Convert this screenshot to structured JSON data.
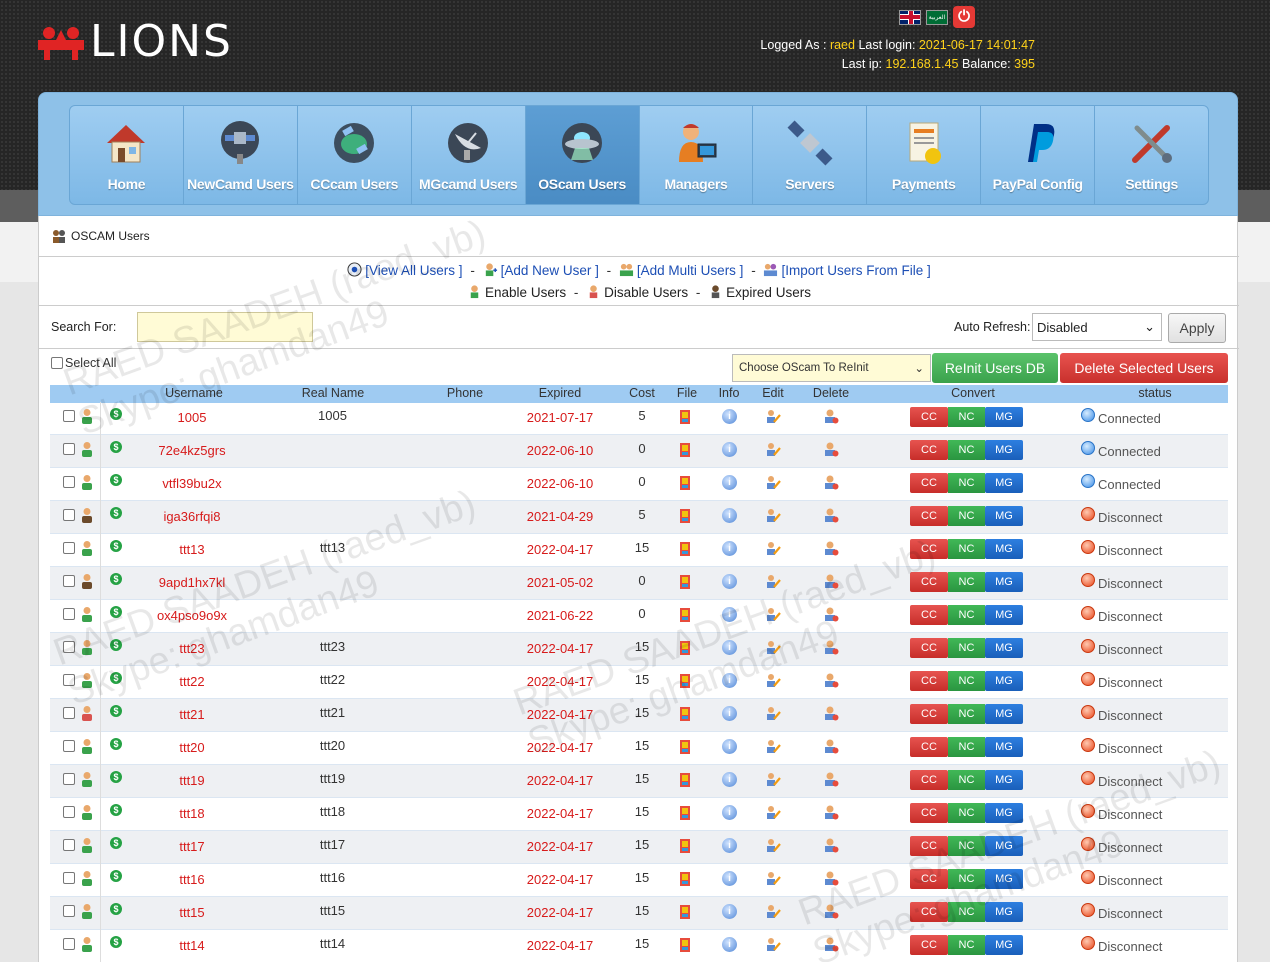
{
  "app": {
    "logo_text": "LIONS",
    "logged_as_label": "Logged As :",
    "logged_as_value": "raed",
    "last_login_label": "Last login:",
    "last_login_value": "2021-06-17 14:01:47",
    "last_ip_label": "Last ip:",
    "last_ip_value": "192.168.1.45",
    "balance_label": "Balance:",
    "balance_value": "395",
    "flag_sa_text": "العربية"
  },
  "nav": [
    {
      "label": "Home",
      "icon": "home-icon"
    },
    {
      "label": "NewCamd Users",
      "icon": "satellite-dish-icon"
    },
    {
      "label": "CCcam Users",
      "icon": "globe-satellite-icon"
    },
    {
      "label": "MGcamd Users",
      "icon": "dish-antenna-icon"
    },
    {
      "label": "OScam Users",
      "icon": "ufo-icon",
      "active": true
    },
    {
      "label": "Managers",
      "icon": "manager-icon"
    },
    {
      "label": "Servers",
      "icon": "satellite-icon"
    },
    {
      "label": "Payments",
      "icon": "invoice-icon"
    },
    {
      "label": "PayPal Config",
      "icon": "paypal-icon"
    },
    {
      "label": "Settings",
      "icon": "tools-icon"
    }
  ],
  "page": {
    "breadcrumb": "OSCAM Users",
    "links": {
      "view_all": "[View All Users ]",
      "add_new": "[Add New User ]",
      "add_multi": "[Add Multi Users ]",
      "import": "[Import Users From File ]",
      "enable": "Enable Users",
      "disable": "Disable Users",
      "expired": "Expired Users",
      "sep": "-"
    },
    "search_label": "Search For:",
    "search_value": "",
    "auto_refresh_label": "Auto Refresh:",
    "auto_refresh_value": "Disabled",
    "apply_label": "Apply",
    "select_all_label": "Select All",
    "reinit_placeholder": "Choose OScam To ReInit",
    "reinit_button": "ReInit Users DB",
    "delete_button": "Delete Selected Users"
  },
  "table": {
    "columns": {
      "username": "Username",
      "real_name": "Real Name",
      "phone": "Phone",
      "expired": "Expired",
      "cost": "Cost",
      "file": "File",
      "info": "Info",
      "edit": "Edit",
      "delete": "Delete",
      "convert": "Convert",
      "status": "status"
    },
    "convert_labels": {
      "cc": "CC",
      "nc": "NC",
      "mg": "MG"
    },
    "rows": [
      {
        "username": "1005",
        "real_name": "1005",
        "expired": "2021-07-17",
        "cost": "5",
        "status": "Connected",
        "online": true
      },
      {
        "username": "72e4kz5grs",
        "real_name": "",
        "expired": "2022-06-10",
        "cost": "0",
        "status": "Connected",
        "online": true
      },
      {
        "username": "vtfl39bu2x",
        "real_name": "",
        "expired": "2022-06-10",
        "cost": "0",
        "status": "Connected",
        "online": true
      },
      {
        "username": "iga36rfqi8",
        "real_name": "",
        "expired": "2021-04-29",
        "cost": "5",
        "status": "Disconnect",
        "online": false
      },
      {
        "username": "ttt13",
        "real_name": "ttt13",
        "expired": "2022-04-17",
        "cost": "15",
        "status": "Disconnect",
        "online": false
      },
      {
        "username": "9apd1hx7kl",
        "real_name": "",
        "expired": "2021-05-02",
        "cost": "0",
        "status": "Disconnect",
        "online": false
      },
      {
        "username": "ox4pso9o9x",
        "real_name": "",
        "expired": "2021-06-22",
        "cost": "0",
        "status": "Disconnect",
        "online": false
      },
      {
        "username": "ttt23",
        "real_name": "ttt23",
        "expired": "2022-04-17",
        "cost": "15",
        "status": "Disconnect",
        "online": false
      },
      {
        "username": "ttt22",
        "real_name": "ttt22",
        "expired": "2022-04-17",
        "cost": "15",
        "status": "Disconnect",
        "online": false
      },
      {
        "username": "ttt21",
        "real_name": "ttt21",
        "expired": "2022-04-17",
        "cost": "15",
        "status": "Disconnect",
        "online": false
      },
      {
        "username": "ttt20",
        "real_name": "ttt20",
        "expired": "2022-04-17",
        "cost": "15",
        "status": "Disconnect",
        "online": false
      },
      {
        "username": "ttt19",
        "real_name": "ttt19",
        "expired": "2022-04-17",
        "cost": "15",
        "status": "Disconnect",
        "online": false
      },
      {
        "username": "ttt18",
        "real_name": "ttt18",
        "expired": "2022-04-17",
        "cost": "15",
        "status": "Disconnect",
        "online": false
      },
      {
        "username": "ttt17",
        "real_name": "ttt17",
        "expired": "2022-04-17",
        "cost": "15",
        "status": "Disconnect",
        "online": false
      },
      {
        "username": "ttt16",
        "real_name": "ttt16",
        "expired": "2022-04-17",
        "cost": "15",
        "status": "Disconnect",
        "online": false
      },
      {
        "username": "ttt15",
        "real_name": "ttt15",
        "expired": "2022-04-17",
        "cost": "15",
        "status": "Disconnect",
        "online": false
      },
      {
        "username": "ttt14",
        "real_name": "ttt14",
        "expired": "2022-04-17",
        "cost": "15",
        "status": "Disconnect",
        "online": false
      }
    ]
  },
  "watermark": {
    "line1": "RAED SAADEH (raed_vb)",
    "line2": "Skype: ghamdan49"
  },
  "colors": {
    "accent_blue": "#8ec1e8",
    "link_blue": "#1d4fb5",
    "expired_red": "#d71b1b",
    "button_green": "#3aa24c",
    "button_red": "#c8302c"
  }
}
